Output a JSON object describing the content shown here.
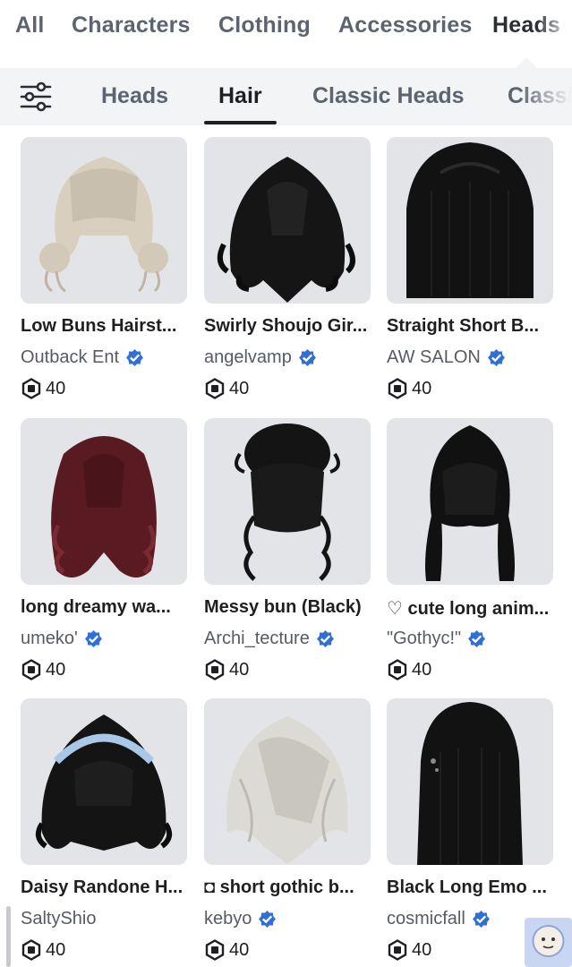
{
  "top_tabs": [
    {
      "label": "All"
    },
    {
      "label": "Characters"
    },
    {
      "label": "Clothing"
    },
    {
      "label": "Accessories"
    },
    {
      "label": "Heads",
      "active": true
    }
  ],
  "sub_tabs": [
    {
      "label": "Heads"
    },
    {
      "label": "Hair",
      "active": true
    },
    {
      "label": "Classic Heads"
    },
    {
      "label": "Classic"
    }
  ],
  "icons": {
    "filter": "sliders-icon",
    "verified": "verified-badge-icon",
    "currency": "robux-icon"
  },
  "colors": {
    "accent": "#1f1f23",
    "verified": "#2f6fd6",
    "card_bg": "#e3e4e8",
    "subbar_bg": "#f3f4f6"
  },
  "items": [
    {
      "name": "Low Buns Hairst...",
      "creator": "Outback Ent",
      "price": "40"
    },
    {
      "name": "Swirly Shoujo Gir...",
      "creator": "angelvamp",
      "price": "40"
    },
    {
      "name": "Straight Short B...",
      "creator": "AW SALON",
      "price": "40"
    },
    {
      "name": "long dreamy wa...",
      "creator": "umeko'",
      "price": "40"
    },
    {
      "name": "Messy bun (Black)",
      "creator": "Archi_tecture",
      "price": "40"
    },
    {
      "name": "♡ cute long anim...",
      "creator": "\"Gothyc!\"",
      "price": "40"
    },
    {
      "name": "Daisy Randone H...",
      "creator": "SaltyShio",
      "price": "40"
    },
    {
      "name": "◘ short gothic b...",
      "creator": "kebyo",
      "price": "40"
    },
    {
      "name": "Black Long Emo ...",
      "creator": "cosmicfall",
      "price": "40"
    }
  ]
}
